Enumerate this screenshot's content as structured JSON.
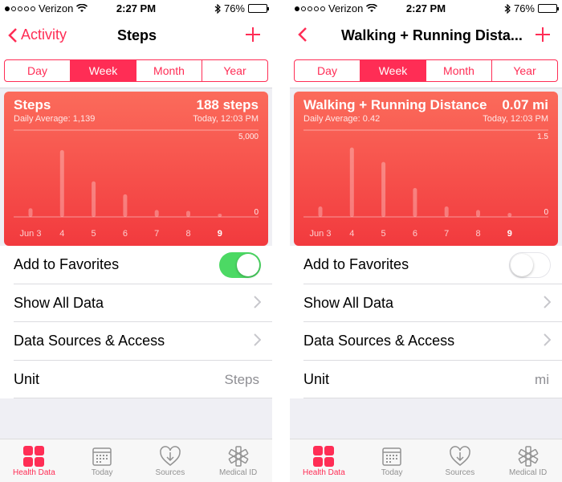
{
  "colors": {
    "accent": "#ff2d55",
    "card_top": "#fb6b5b",
    "card_bottom": "#f23a3e",
    "toggle_on": "#4cd964"
  },
  "screens": [
    {
      "status": {
        "carrier": "Verizon",
        "time": "2:27 PM",
        "battery": "76%"
      },
      "nav": {
        "back_label": "Activity",
        "title": "Steps",
        "add_icon": "plus-icon"
      },
      "segments": {
        "items": [
          "Day",
          "Week",
          "Month",
          "Year"
        ],
        "selected": "Week"
      },
      "card": {
        "title": "Steps",
        "value": "188 steps",
        "subtitle_left": "Daily Average: 1,139",
        "subtitle_right": "Today, 12:03 PM"
      },
      "chart_data": {
        "type": "bar",
        "categories": [
          "Jun 3",
          "4",
          "5",
          "6",
          "7",
          "8",
          "9"
        ],
        "values": [
          500,
          3850,
          2050,
          1300,
          400,
          350,
          188
        ],
        "y_tick_labels": [
          "5,000",
          "0"
        ],
        "ylim": [
          0,
          5000
        ],
        "highlighted_category": "9"
      },
      "rows": {
        "favorites": {
          "label": "Add to Favorites",
          "on": true
        },
        "show_all": {
          "label": "Show All Data"
        },
        "sources": {
          "label": "Data Sources & Access"
        },
        "unit": {
          "label": "Unit",
          "value": "Steps"
        }
      },
      "tabs": [
        {
          "label": "Health Data",
          "icon": "grid-icon",
          "active": true
        },
        {
          "label": "Today",
          "icon": "calendar-icon",
          "active": false
        },
        {
          "label": "Sources",
          "icon": "heart-download-icon",
          "active": false
        },
        {
          "label": "Medical ID",
          "icon": "medical-star-icon",
          "active": false
        }
      ]
    },
    {
      "status": {
        "carrier": "Verizon",
        "time": "2:27 PM",
        "battery": "76%"
      },
      "nav": {
        "back_label": "",
        "title": "Walking + Running Dista...",
        "add_icon": "plus-icon"
      },
      "segments": {
        "items": [
          "Day",
          "Week",
          "Month",
          "Year"
        ],
        "selected": "Week"
      },
      "card": {
        "title": "Walking + Running Distance",
        "value": "0.07 mi",
        "subtitle_left": "Daily Average: 0.42",
        "subtitle_right": "Today, 12:03 PM"
      },
      "chart_data": {
        "type": "bar",
        "categories": [
          "Jun 3",
          "4",
          "5",
          "6",
          "7",
          "8",
          "9"
        ],
        "values": [
          0.18,
          1.2,
          0.95,
          0.5,
          0.18,
          0.12,
          0.07
        ],
        "y_tick_labels": [
          "1.5",
          "0"
        ],
        "ylim": [
          0,
          1.5
        ],
        "highlighted_category": "9"
      },
      "rows": {
        "favorites": {
          "label": "Add to Favorites",
          "on": false
        },
        "show_all": {
          "label": "Show All Data"
        },
        "sources": {
          "label": "Data Sources & Access"
        },
        "unit": {
          "label": "Unit",
          "value": "mi"
        }
      },
      "tabs": [
        {
          "label": "Health Data",
          "icon": "grid-icon",
          "active": true
        },
        {
          "label": "Today",
          "icon": "calendar-icon",
          "active": false
        },
        {
          "label": "Sources",
          "icon": "heart-download-icon",
          "active": false
        },
        {
          "label": "Medical ID",
          "icon": "medical-star-icon",
          "active": false
        }
      ]
    }
  ]
}
